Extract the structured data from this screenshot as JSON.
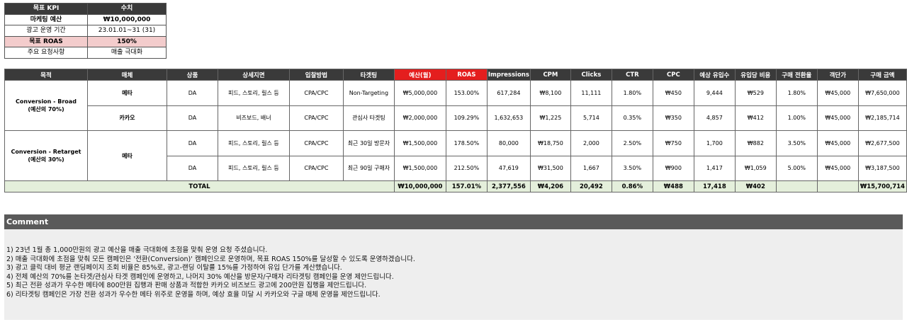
{
  "kpi": {
    "header": {
      "key": "목표 KPI",
      "value": "수치"
    },
    "rows": [
      {
        "key": "마케팅 예산",
        "value": "₩10,000,000",
        "style": "bold"
      },
      {
        "key": "광고 운영 기간",
        "value": "23.01.01~31 (31)",
        "style": ""
      },
      {
        "key": "목표 ROAS",
        "value": "150%",
        "style": "pink"
      },
      {
        "key": "주요 요청사항",
        "value": "매출 극대화",
        "style": ""
      }
    ]
  },
  "table": {
    "headers": [
      "목적",
      "매체",
      "상품",
      "상세지면",
      "입찰방법",
      "타겟팅",
      "예산(월)",
      "ROAS",
      "Impressions",
      "CPM",
      "Clicks",
      "CTR",
      "CPC",
      "예상 유입수",
      "유입당 비용",
      "구매 전환율",
      "객단가",
      "구매 금액"
    ],
    "groups": [
      {
        "objective_line1": "Conversion - Broad",
        "objective_line2": "(예산의 70%)",
        "rows": [
          {
            "media": "메타",
            "product": "DA",
            "placement": "피드, 스토리, 릴스 등",
            "bid": "CPA/CPC",
            "targeting": "Non-Targeting",
            "budget": "₩5,000,000",
            "roas": "153.00%",
            "impressions": "617,284",
            "cpm": "₩8,100",
            "clicks": "11,111",
            "ctr": "1.80%",
            "cpc": "₩450",
            "visits": "9,444",
            "cost_per_visit": "₩529",
            "cvr": "1.80%",
            "aov": "₩45,000",
            "revenue": "₩7,650,000"
          },
          {
            "media": "카카오",
            "product": "DA",
            "placement": "비즈보드, 배너",
            "bid": "CPA/CPC",
            "targeting": "관심사 타겟팅",
            "budget": "₩2,000,000",
            "roas": "109.29%",
            "impressions": "1,632,653",
            "cpm": "₩1,225",
            "clicks": "5,714",
            "ctr": "0.35%",
            "cpc": "₩350",
            "visits": "4,857",
            "cost_per_visit": "₩412",
            "cvr": "1.00%",
            "aov": "₩45,000",
            "revenue": "₩2,185,714"
          }
        ]
      },
      {
        "objective_line1": "Conversion - Retarget",
        "objective_line2": "(예산의 30%)",
        "media": "메타",
        "rows": [
          {
            "product": "DA",
            "placement": "피드, 스토리, 릴스 등",
            "bid": "CPA/CPC",
            "targeting": "최근 30일 방문자",
            "budget": "₩1,500,000",
            "roas": "178.50%",
            "impressions": "80,000",
            "cpm": "₩18,750",
            "clicks": "2,000",
            "ctr": "2.50%",
            "cpc": "₩750",
            "visits": "1,700",
            "cost_per_visit": "₩882",
            "cvr": "3.50%",
            "aov": "₩45,000",
            "revenue": "₩2,677,500"
          },
          {
            "product": "DA",
            "placement": "피드, 스토리, 릴스 등",
            "bid": "CPA/CPC",
            "targeting": "최근 90일 구매자",
            "budget": "₩1,500,000",
            "roas": "212.50%",
            "impressions": "47,619",
            "cpm": "₩31,500",
            "clicks": "1,667",
            "ctr": "3.50%",
            "cpc": "₩900",
            "visits": "1,417",
            "cost_per_visit": "₩1,059",
            "cvr": "5.00%",
            "aov": "₩45,000",
            "revenue": "₩3,187,500"
          }
        ]
      }
    ],
    "total": {
      "label": "TOTAL",
      "budget": "₩10,000,000",
      "roas": "157.01%",
      "impressions": "2,377,556",
      "cpm": "₩4,206",
      "clicks": "20,492",
      "ctr": "0.86%",
      "cpc": "₩488",
      "visits": "17,418",
      "cost_per_visit": "₩402",
      "cvr": "",
      "aov": "",
      "revenue": "₩15,700,714"
    }
  },
  "comment": {
    "title": "Comment",
    "lines": [
      "1) 23년 1월 총 1,000만원의 광고 예산을 매출 극대화에 초점을 맞춰 운영 요청 주셨습니다.",
      "2) 매출 극대화에 초점을 맞춰 모든 캠페인은 '전환(Conversion)' 캠페인으로 운영하며, 목표 ROAS 150%를 달성할 수 있도록 운영하겠습니다.",
      "3) 광고 클릭 대비 평균 랜딩페이지 조회 비율은 85%로, 광고-랜딩 이탈률 15%를 가정하여 유입 단가를 계산했습니다.",
      "4) 전체 예산의 70%를 논타겟/관심사 타겟 캠페인에 운영하고, 나머지 30% 예산을 방문자/구매자 리타겟팅 캠페인을 운영 제안드립니다.",
      "5) 최근 전환 성과가 우수한 메타에 800만원 집행과 판매 상품과 적합한 카카오 비즈보드 광고에 200만원 집행을 제안드립니다.",
      "6) 리타겟팅 캠페인은 가장 전환 성과가 우수한 메타 위주로 운영을 하며, 예상 효율 미달 시 카카오와 구글 매체 운영을 제안드립니다."
    ]
  }
}
